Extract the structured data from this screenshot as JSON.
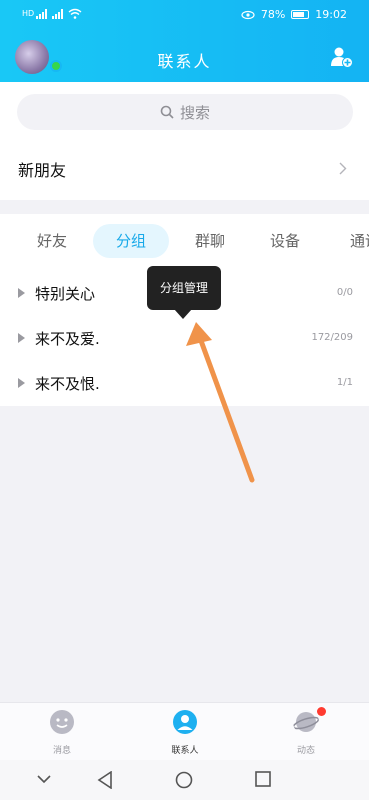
{
  "status_bar": {
    "left_label": "HD",
    "battery_percent": "78%",
    "time": "19:02"
  },
  "header": {
    "title": "联系人"
  },
  "search": {
    "placeholder": "搜索"
  },
  "new_friends": {
    "label": "新朋友"
  },
  "tabs": [
    {
      "label": "好友"
    },
    {
      "label": "分组"
    },
    {
      "label": "群聊"
    },
    {
      "label": "设备"
    },
    {
      "label": "通讯"
    }
  ],
  "active_tab": "分组",
  "groups": [
    {
      "name": "特别关心",
      "count": "0/0"
    },
    {
      "name": "来不及爱.",
      "count": "172/209"
    },
    {
      "name": "来不及恨.",
      "count": "1/1"
    }
  ],
  "tooltip": {
    "text": "分组管理"
  },
  "bottom_nav": [
    {
      "label": "消息"
    },
    {
      "label": "联系人"
    },
    {
      "label": "动态"
    }
  ],
  "colors": {
    "accent": "#17b8f4",
    "annotation_arrow": "#f0934a",
    "badge": "#ff3b30"
  }
}
